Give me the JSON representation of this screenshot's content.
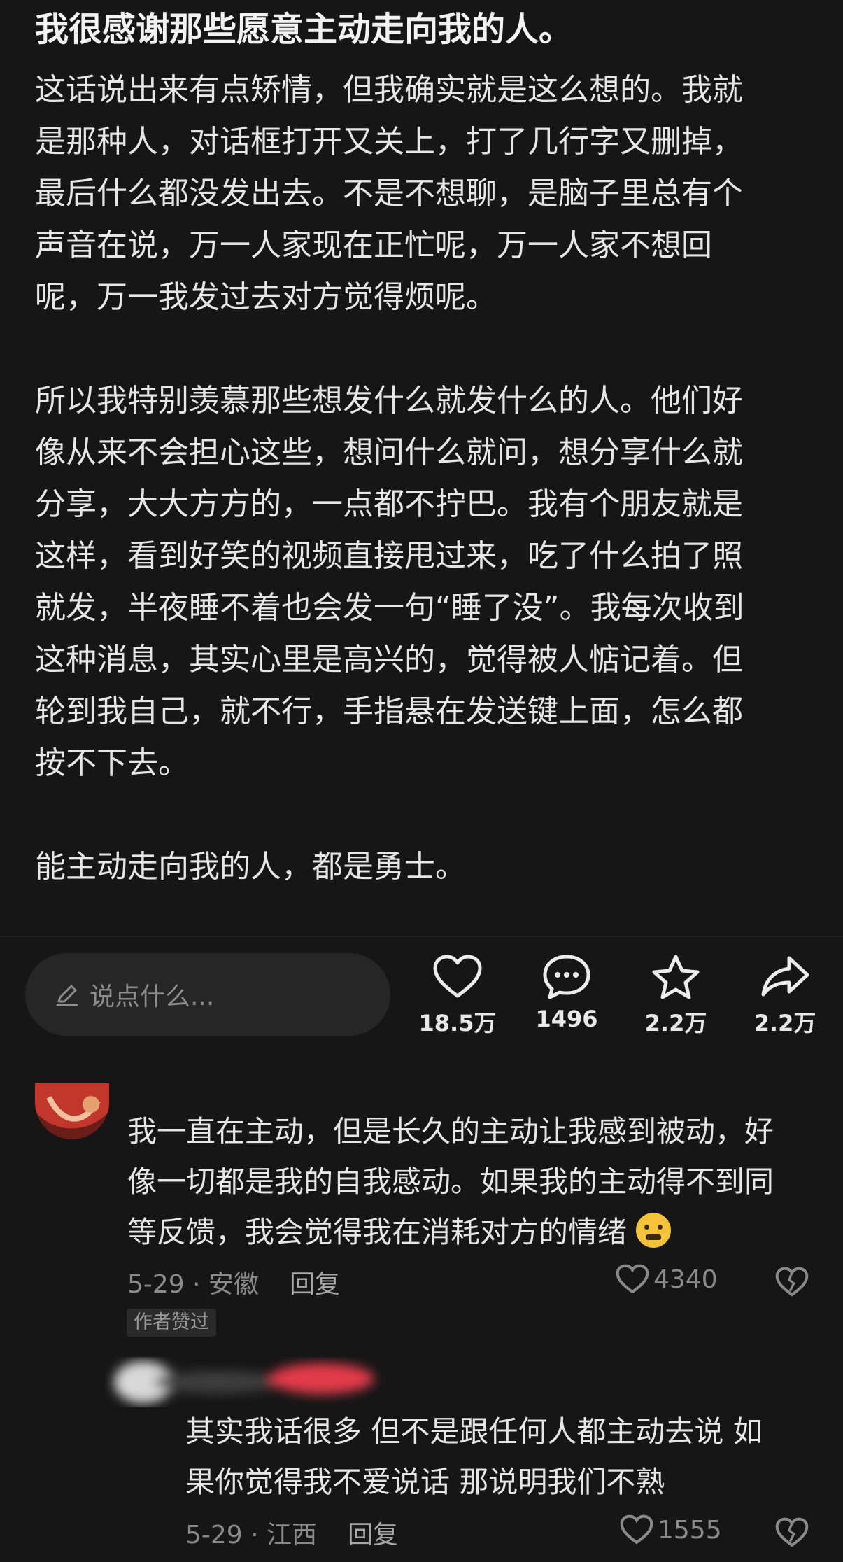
{
  "post": {
    "title": "我很感谢那些愿意主动走向我的人。",
    "paragraph1": [
      "这话说出来有点矫情，但我确实就是这么想的。我就",
      "是那种人，对话框打开又关上，打了几行字又删掉，",
      "最后什么都没发出去。不是不想聊，是脑子里总有个",
      "声音在说，万一人家现在正忙呢，万一人家不想回",
      "呢，万一我发过去对方觉得烦呢。"
    ],
    "paragraph2": [
      "所以我特别羡慕那些想发什么就发什么的人。他们好",
      "像从来不会担心这些，想问什么就问，想分享什么就",
      "分享，大大方方的，一点都不拧巴。我有个朋友就是",
      "这样，看到好笑的视频直接甩过来，吃了什么拍了照",
      "就发，半夜睡不着也会发一句“睡了没”。我每次收到",
      "这种消息，其实心里是高兴的，觉得被人惦记着。但",
      "轮到我自己，就不行，手指悬在发送键上面，怎么都",
      "按不下去。"
    ],
    "paragraph3": "能主动走向我的人，都是勇士。"
  },
  "input": {
    "placeholder": "说点什么..."
  },
  "actions": {
    "like_count": "18.5万",
    "comment_count": "1496",
    "favorite_count": "2.2万",
    "share_count": "2.2万"
  },
  "comments": [
    {
      "lines": [
        "我一直在主动，但是长久的主动让我感到被动，好",
        "像一切都是我的自我感动。如果我的主动得不到同",
        "等反馈，我会觉得我在消耗对方的情绪"
      ],
      "date_location": "5-29 · 安徽",
      "reply_label": "回复",
      "likes": "4340",
      "badge": "作者赞过",
      "emoji": "worried-face-icon"
    },
    {
      "lines": [
        "其实我话很多 但不是跟任何人都主动去说 如",
        "果你觉得我不爱说话 那说明我们不熟"
      ],
      "date_location": "5-29 · 江西",
      "reply_label": "回复",
      "likes": "1555"
    }
  ],
  "colors": {
    "background": "#161616",
    "text": "#e6e6e6",
    "muted": "#8a8a8a",
    "input_bg": "#262626"
  }
}
